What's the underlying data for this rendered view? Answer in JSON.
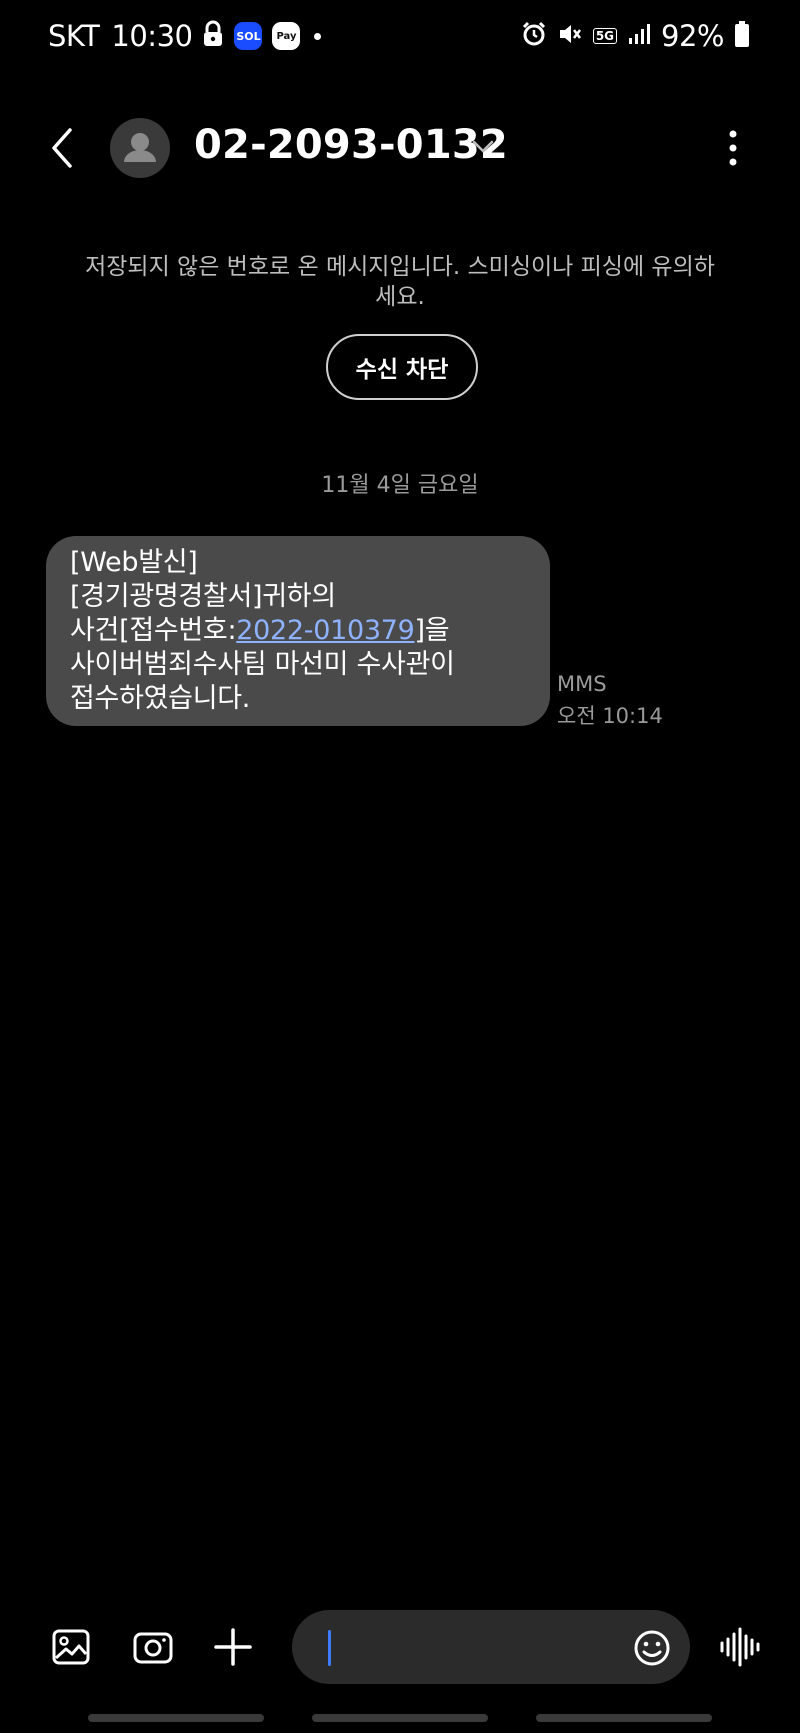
{
  "status_bar": {
    "carrier": "SKT",
    "time": "10:30",
    "sol_badge": "SOL",
    "pay_badge": "Pay",
    "network": "5G",
    "battery": "92%",
    "icons": [
      "lock-icon",
      "alarm-icon",
      "mute-icon",
      "signal-icon",
      "battery-icon"
    ]
  },
  "header": {
    "contact": "02-2093-0132"
  },
  "notice": {
    "text": "저장되지 않은 번호로 온 메시지입니다. 스미싱이나 피싱에 유의하세요.",
    "block_button": "수신 차단"
  },
  "date_divider": "11월 4일 금요일",
  "message": {
    "lines": [
      "[Web발신]",
      "[경기광명경찰서]귀하의",
      "사건[접수번호:",
      "2022-010379",
      "]을",
      "사이버범죄수사팀 마선미 수사관이",
      "접수하였습니다."
    ],
    "type": "MMS",
    "time": "오전 10:14"
  },
  "composer": {
    "input_value": ""
  },
  "colors": {
    "background": "#000000",
    "bubble": "#4a4a4a",
    "link": "#8fb2ff",
    "caret": "#3d7bff"
  }
}
